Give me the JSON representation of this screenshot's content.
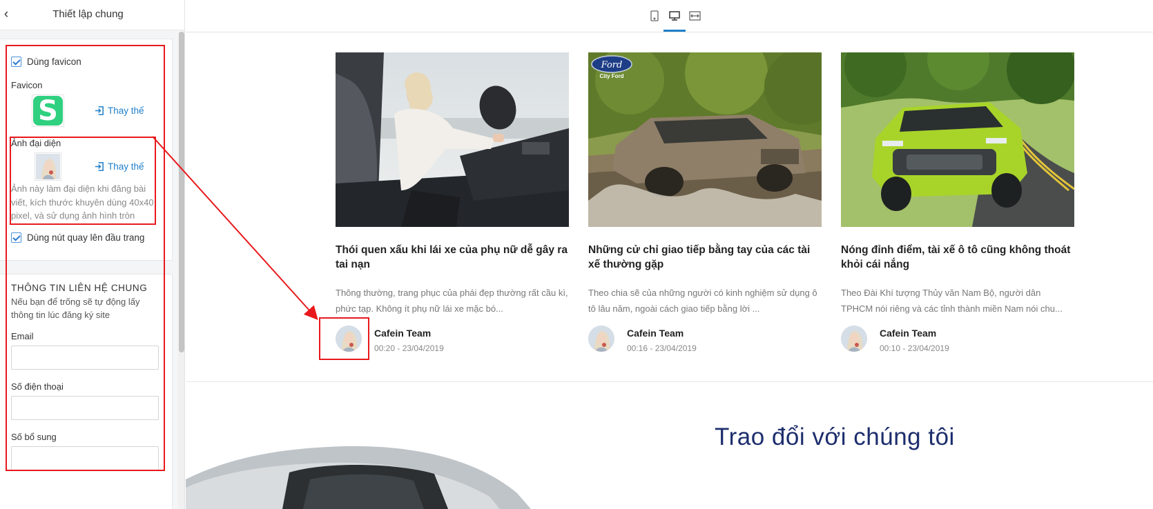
{
  "sidebar": {
    "title": "Thiết lập chung",
    "use_favicon_label": "Dùng favicon",
    "favicon_label": "Favicon",
    "favicon_replace": "Thay thế",
    "avatar_label": "Ảnh đại diện",
    "avatar_replace": "Thay thế",
    "avatar_help": "Ảnh này làm đại diện khi đăng bài viết, kích thước khuyên dùng 40x40 pixel, và sử dụng ảnh hình tròn",
    "back_to_top_label": "Dùng nút quay lên đầu trang",
    "contact": {
      "title": "THÔNG TIN LIÊN HỆ CHUNG",
      "description": "Nếu bạn để trống sẽ tự động lấy thông tin lúc đăng ký site",
      "email_label": "Email",
      "email_value": "",
      "phone_label": "Số điện thoại",
      "phone_value": "",
      "extra_label": "Số bổ sung",
      "extra_value": ""
    }
  },
  "toolbar": {
    "devices": [
      "mobile-icon",
      "desktop-icon",
      "fullwidth-icon"
    ],
    "active_device": "desktop-icon",
    "accent_color": "#1f7fc9"
  },
  "posts": [
    {
      "title": "Thói quen xấu khi lái xe của phụ nữ dễ gây ra tai nạn",
      "excerpt": "Thông thường, trang phục của phái đẹp thường rất cầu kì, phức tạp. Không ít phụ nữ lái xe mặc bó...",
      "author": "Cafein Team",
      "date": "00:20 - 23/04/2019"
    },
    {
      "title": "Những cử chỉ giao tiếp bằng tay của các tài xế thường gặp",
      "excerpt": "Theo chia sẽ của những người có kinh nghiệm sử dụng ô tô lâu năm, ngoài cách giao tiếp bằng lời ...",
      "author": "Cafein Team",
      "date": "00:16 - 23/04/2019",
      "logo_brand": "Ford",
      "logo_sub": "City Ford"
    },
    {
      "title": "Nóng đỉnh điểm, tài xế ô tô cũng không thoát khỏi cái nắng",
      "excerpt": "Theo Đài Khí tượng Thủy văn Nam Bộ, người dân TPHCM nói riêng và các tỉnh thành miền Nam nói chu...",
      "author": "Cafein Team",
      "date": "00:10 - 23/04/2019"
    }
  ],
  "contact_section": {
    "heading": "Trao đổi với chúng tôi",
    "heading_color": "#1d2e6d"
  },
  "annotation_color": "#e8191c",
  "favicon_color": "#2fd07f"
}
